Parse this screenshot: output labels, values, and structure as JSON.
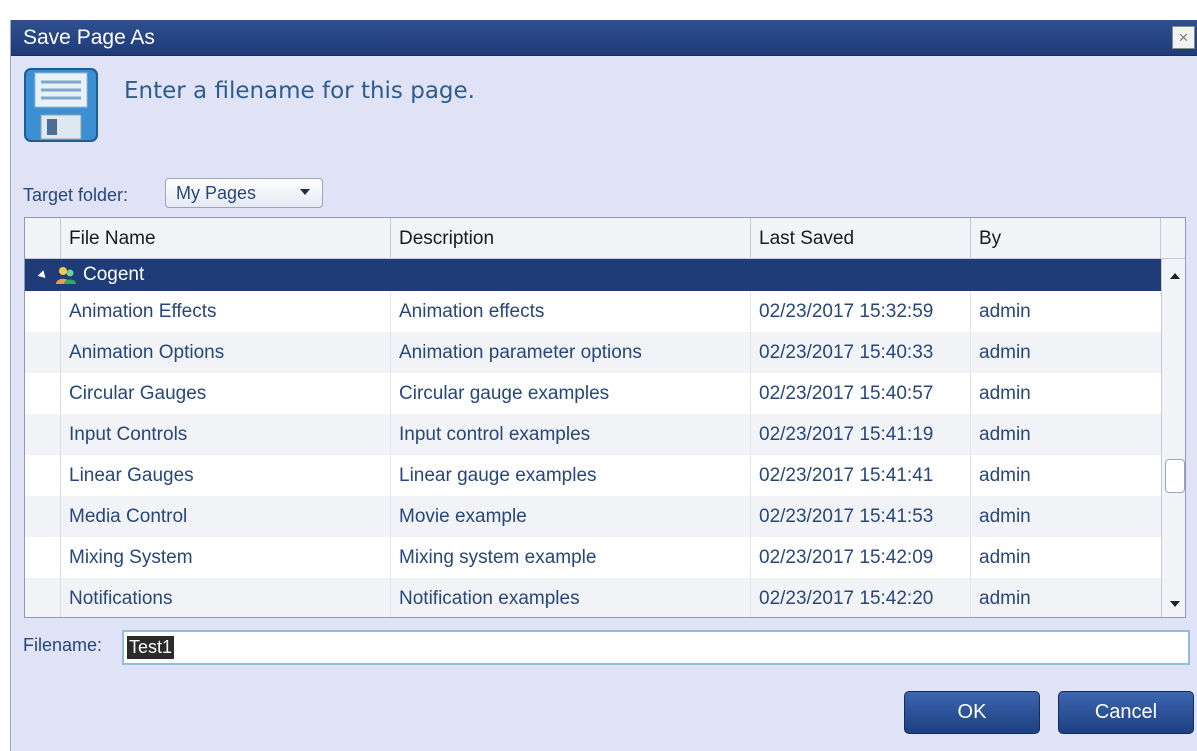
{
  "dialog": {
    "title": "Save Page As",
    "close_glyph": "×",
    "prompt": "Enter a filename for this page.",
    "icon": "floppy-disk-icon"
  },
  "folder": {
    "label": "Target folder:",
    "selected": "My Pages"
  },
  "grid": {
    "columns": [
      "File Name",
      "Description",
      "Last Saved",
      "By"
    ],
    "group": "Cogent",
    "rows": [
      {
        "name": "Animation Effects",
        "description": "Animation effects",
        "saved": "02/23/2017 15:32:59",
        "by": "admin"
      },
      {
        "name": "Animation Options",
        "description": "Animation parameter options",
        "saved": "02/23/2017 15:40:33",
        "by": "admin"
      },
      {
        "name": "Circular Gauges",
        "description": "Circular gauge examples",
        "saved": "02/23/2017 15:40:57",
        "by": "admin"
      },
      {
        "name": "Input Controls",
        "description": "Input control examples",
        "saved": "02/23/2017 15:41:19",
        "by": "admin"
      },
      {
        "name": "Linear Gauges",
        "description": "Linear gauge examples",
        "saved": "02/23/2017 15:41:41",
        "by": "admin"
      },
      {
        "name": "Media Control",
        "description": "Movie example",
        "saved": "02/23/2017 15:41:53",
        "by": "admin"
      },
      {
        "name": "Mixing System",
        "description": "Mixing system example",
        "saved": "02/23/2017 15:42:09",
        "by": "admin"
      },
      {
        "name": "Notifications",
        "description": "Notification examples",
        "saved": "02/23/2017 15:42:20",
        "by": "admin"
      }
    ]
  },
  "filename": {
    "label": "Filename:",
    "value": "Test1"
  },
  "buttons": {
    "ok": "OK",
    "cancel": "Cancel"
  },
  "colors": {
    "titlebar": "#1f3c78",
    "dialog_bg": "#dfe3f5",
    "link_text": "#27477a",
    "button": "#2a4f96"
  }
}
